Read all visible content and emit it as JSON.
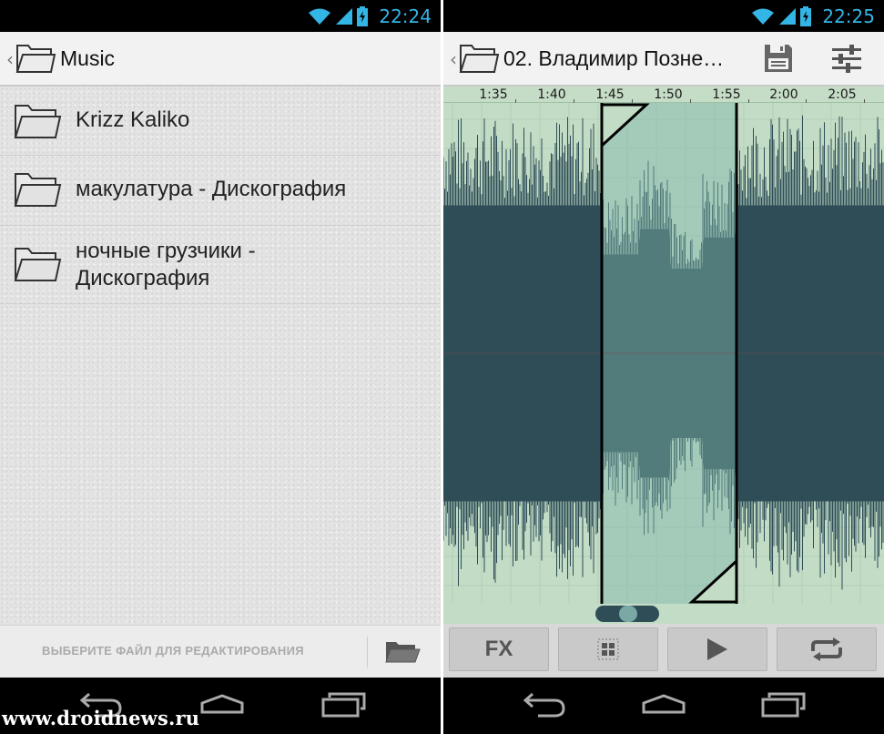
{
  "left_screen": {
    "status_time": "22:24",
    "title": "Music",
    "folders": [
      {
        "label": "Krizz Kaliko"
      },
      {
        "label": "макулатура - Дискография"
      },
      {
        "label": "ночные грузчики -\nДискография"
      }
    ],
    "bottom_hint": "ВЫБЕРИТЕ ФАЙЛ ДЛЯ РЕДАКТИРОВАНИЯ"
  },
  "right_screen": {
    "status_time": "22:25",
    "title": "02. Владимир Позне…",
    "timeline": [
      "1:35",
      "1:40",
      "1:45",
      "1:50",
      "1:55",
      "2:00",
      "2:05"
    ],
    "controls": {
      "fx_label": "FX"
    }
  },
  "watermark": "www.droidnews.ru",
  "icons": [
    "folder-icon",
    "wifi-icon",
    "signal-icon",
    "battery-icon",
    "save-icon",
    "equalizer-icon",
    "grid-icon",
    "play-icon",
    "repeat-icon",
    "back-icon",
    "home-icon",
    "recents-icon"
  ],
  "colors": {
    "status_accent": "#33b5e5",
    "waveform": "#2e4d57",
    "waveform_bg": "#c3dcc5",
    "selection": "#7fb3aa"
  }
}
